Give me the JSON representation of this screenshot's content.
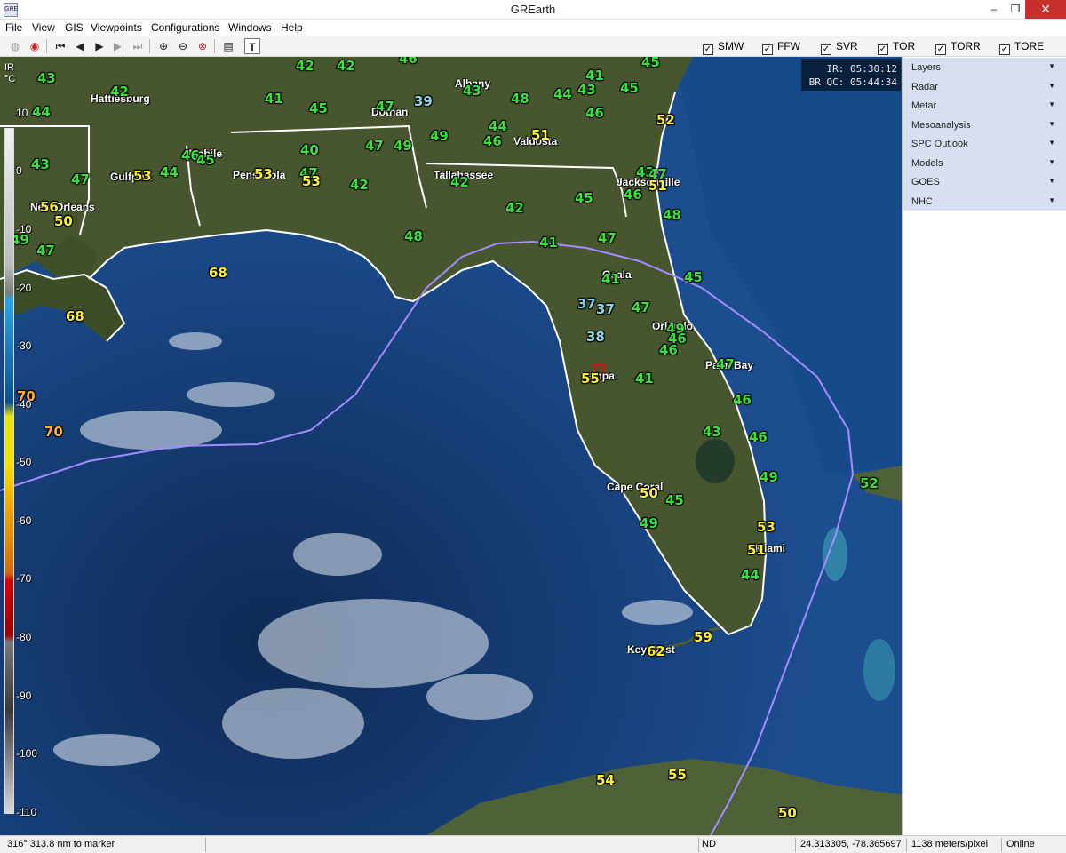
{
  "window": {
    "title": "GREarth",
    "icon_text": "GRE",
    "min": "–",
    "max": "❐",
    "close": "✕"
  },
  "menu": [
    "File",
    "View",
    "GIS",
    "Viewpoints",
    "Configurations",
    "Windows",
    "Help"
  ],
  "toolbar_icons": [
    "globe-icon",
    "radar-icon",
    "first-frame-icon",
    "prev-frame-icon",
    "play-icon",
    "next-frame-icon",
    "last-frame-icon",
    "zoom-in-icon",
    "zoom-out-icon",
    "zoom-reset-icon",
    "list-icon",
    "text-icon"
  ],
  "warnings": [
    {
      "label": "SMW",
      "checked": true
    },
    {
      "label": "FFW",
      "checked": true
    },
    {
      "label": "SVR",
      "checked": true
    },
    {
      "label": "TOR",
      "checked": true
    },
    {
      "label": "TORR",
      "checked": true
    },
    {
      "label": "TORE",
      "checked": true
    }
  ],
  "legend": {
    "line1": "IR",
    "line2": "°C",
    "ticks": [
      "10",
      "0",
      "-10",
      "-20",
      "-30",
      "-40",
      "-50",
      "-60",
      "-70",
      "-80",
      "-90",
      "-100",
      "-110"
    ]
  },
  "time_box": {
    "ir": "IR: 05:30:12",
    "br": "BR QC: 05:44:34"
  },
  "panel_items": [
    "Layers",
    "Radar",
    "Metar",
    "Mesoanalysis",
    "SPC Outlook",
    "Models",
    "GOES",
    "NHC"
  ],
  "cities": [
    "Hattiesburg",
    "Albany",
    "Dothan",
    "Valdosta",
    "Mobile",
    "Pensacola",
    "Gulfport",
    "Tallahassee",
    "Jacksonville",
    "New Orleans",
    "Ocala",
    "Orlando",
    "Palm Bay",
    "Tampa",
    "Cape Coral",
    "Miami",
    "Key West"
  ],
  "temps": [
    "43",
    "42",
    "42",
    "46",
    "41",
    "45",
    "44",
    "42",
    "41",
    "45",
    "47",
    "39",
    "43",
    "48",
    "44",
    "43",
    "45",
    "44",
    "46",
    "46",
    "52",
    "43",
    "40",
    "47",
    "49",
    "49",
    "46",
    "45",
    "51",
    "47",
    "44",
    "47",
    "53",
    "43",
    "53",
    "47",
    "53",
    "42",
    "42",
    "46",
    "45",
    "51",
    "56",
    "50",
    "48",
    "42",
    "48",
    "49",
    "47",
    "41",
    "47",
    "68",
    "41",
    "45",
    "68",
    "37",
    "37",
    "47",
    "49",
    "46",
    "38",
    "46",
    "47",
    "41",
    "55",
    "41",
    "46",
    "70",
    "70",
    "43",
    "46",
    "49",
    "52",
    "50",
    "45",
    "49",
    "53",
    "51",
    "44",
    "59",
    "62",
    "54",
    "55",
    "50",
    "47",
    "46"
  ],
  "status": {
    "bearing": "316°  313.8 nm to marker",
    "nd": "ND",
    "coords": "24.313305, -78.365697",
    "scale": "1138 meters/pixel",
    "online": "Online"
  },
  "colors": {
    "ocean": "#1c4d8f",
    "land": "#4a5a35",
    "temp_green": "#39e03a",
    "temp_yellow": "#f7ef3c",
    "nhc_track": "#a58cff",
    "close_btn": "#c7312b"
  }
}
